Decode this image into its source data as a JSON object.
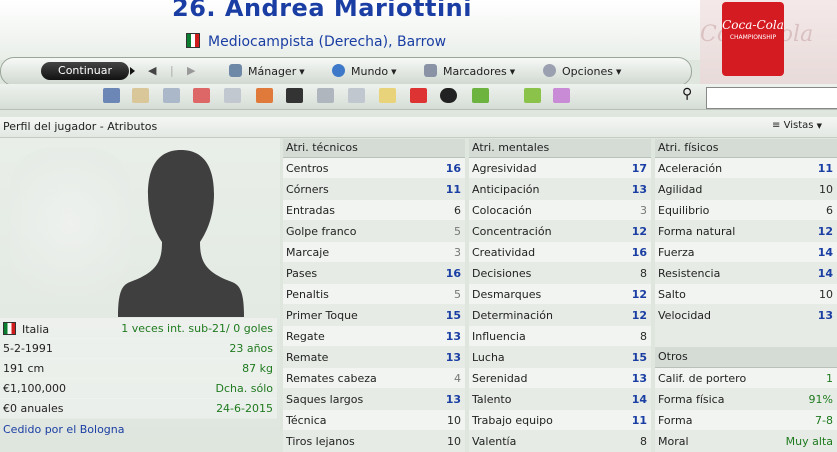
{
  "header": {
    "title": "26. Andrea Mariottini",
    "subtitle": "Mediocampista (Derecha), Barrow",
    "competition_logo": {
      "brand": "Coca-Cola",
      "line": "CHAMPIONSHIP",
      "color": "#d51b22"
    }
  },
  "menubar": {
    "continue_label": "Continuar",
    "menus": [
      {
        "label": "Mánager",
        "icon": "manager-icon"
      },
      {
        "label": "Mundo",
        "icon": "globe-icon"
      },
      {
        "label": "Marcadores",
        "icon": "bookmark-icon"
      },
      {
        "label": "Opciones",
        "icon": "options-icon"
      }
    ]
  },
  "toolbar": {
    "icons": [
      "home-icon",
      "team-icon",
      "news-icon",
      "calendar-icon",
      "squad-icon",
      "transfer-icon",
      "tactics-icon",
      "trophy-icon",
      "scout-icon",
      "clipboard-icon",
      "training-icon",
      "binoculars-icon",
      "finance-icon",
      "help-icon",
      "question-icon"
    ],
    "search_placeholder": ""
  },
  "section": {
    "title": "Perfil del jugador - Atributos",
    "views_label": "Vistas"
  },
  "profile": {
    "nationality": "Italia",
    "caps": "1 veces int. sub-21/ 0 goles",
    "birth_date": "5-2-1991",
    "age": "23 años",
    "height": "191 cm",
    "weight": "87 kg",
    "value": "€1,100,000",
    "foot": "Dcha. sólo",
    "wage": "€0 anuales",
    "contract_end": "24-6-2015",
    "loan": "Cedido por el Bologna"
  },
  "technical": {
    "header": "Atri. técnicos",
    "rows": [
      {
        "name": "Centros",
        "value": "16",
        "tone": "hi"
      },
      {
        "name": "Córners",
        "value": "11",
        "tone": "hi"
      },
      {
        "name": "Entradas",
        "value": "6",
        "tone": "mid"
      },
      {
        "name": "Golpe franco",
        "value": "5",
        "tone": "lo"
      },
      {
        "name": "Marcaje",
        "value": "3",
        "tone": "lo"
      },
      {
        "name": "Pases",
        "value": "16",
        "tone": "hi"
      },
      {
        "name": "Penaltis",
        "value": "5",
        "tone": "lo"
      },
      {
        "name": "Primer Toque",
        "value": "15",
        "tone": "hi"
      },
      {
        "name": "Regate",
        "value": "13",
        "tone": "hi"
      },
      {
        "name": "Remate",
        "value": "13",
        "tone": "hi"
      },
      {
        "name": "Remates cabeza",
        "value": "4",
        "tone": "lo"
      },
      {
        "name": "Saques largos",
        "value": "13",
        "tone": "hi"
      },
      {
        "name": "Técnica",
        "value": "10",
        "tone": "mid"
      },
      {
        "name": "Tiros lejanos",
        "value": "10",
        "tone": "mid"
      }
    ]
  },
  "mental": {
    "header": "Atri. mentales",
    "rows": [
      {
        "name": "Agresividad",
        "value": "17",
        "tone": "hi"
      },
      {
        "name": "Anticipación",
        "value": "13",
        "tone": "hi"
      },
      {
        "name": "Colocación",
        "value": "3",
        "tone": "lo"
      },
      {
        "name": "Concentración",
        "value": "12",
        "tone": "hi"
      },
      {
        "name": "Creatividad",
        "value": "16",
        "tone": "hi"
      },
      {
        "name": "Decisiones",
        "value": "8",
        "tone": "mid"
      },
      {
        "name": "Desmarques",
        "value": "12",
        "tone": "hi"
      },
      {
        "name": "Determinación",
        "value": "12",
        "tone": "hi"
      },
      {
        "name": "Influencia",
        "value": "8",
        "tone": "mid"
      },
      {
        "name": "Lucha",
        "value": "15",
        "tone": "hi"
      },
      {
        "name": "Serenidad",
        "value": "13",
        "tone": "hi"
      },
      {
        "name": "Talento",
        "value": "14",
        "tone": "hi"
      },
      {
        "name": "Trabajo equipo",
        "value": "11",
        "tone": "hi"
      },
      {
        "name": "Valentía",
        "value": "8",
        "tone": "mid"
      }
    ]
  },
  "physical": {
    "header": "Atri. físicos",
    "rows": [
      {
        "name": "Aceleración",
        "value": "11",
        "tone": "hi"
      },
      {
        "name": "Agilidad",
        "value": "10",
        "tone": "mid"
      },
      {
        "name": "Equilibrio",
        "value": "6",
        "tone": "mid"
      },
      {
        "name": "Forma natural",
        "value": "12",
        "tone": "hi"
      },
      {
        "name": "Fuerza",
        "value": "14",
        "tone": "hi"
      },
      {
        "name": "Resistencia",
        "value": "14",
        "tone": "hi"
      },
      {
        "name": "Salto",
        "value": "10",
        "tone": "mid"
      },
      {
        "name": "Velocidad",
        "value": "13",
        "tone": "hi"
      }
    ],
    "others_header": "Otros",
    "others": [
      {
        "name": "Calif. de portero",
        "value": "1",
        "tone": "green"
      },
      {
        "name": "Forma física",
        "value": "91%",
        "tone": "green"
      },
      {
        "name": "Forma",
        "value": "7-8",
        "tone": "green"
      },
      {
        "name": "Moral",
        "value": "Muy alta",
        "tone": "green"
      }
    ]
  }
}
